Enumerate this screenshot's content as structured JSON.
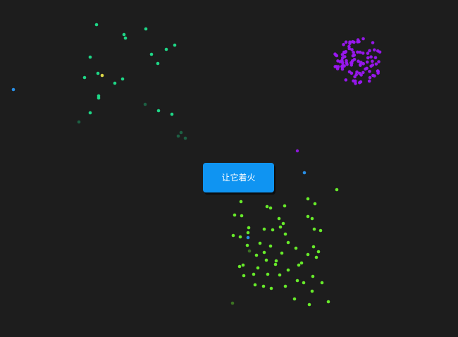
{
  "button": {
    "label": "让它着火",
    "color": "#0f94f2"
  },
  "background_color": "#1d1d1d",
  "fireworks": {
    "purple_burst_color": "#9b17f2",
    "green_burst_color": "#6cf52b",
    "teal_burst_color": "#1fe08c",
    "stray_blue_color": "#2a95f0",
    "stray_yellow_color": "#e7e24a"
  }
}
